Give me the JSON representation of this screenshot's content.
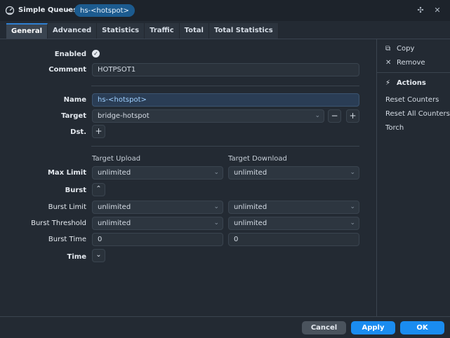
{
  "titlebar": {
    "title": "Simple Queues",
    "breadcrumb_sep": "›",
    "item": "hs-<hotspot>",
    "pin_icon": "pin-icon",
    "close_icon": "close-icon"
  },
  "tabs": [
    "General",
    "Advanced",
    "Statistics",
    "Traffic",
    "Total",
    "Total Statistics"
  ],
  "form": {
    "enabled_label": "Enabled",
    "enabled": true,
    "comment_label": "Comment",
    "comment_value": "HOTPSOT1",
    "name_label": "Name",
    "name_value": "hs-<hotspot>",
    "target_label": "Target",
    "target_value": "bridge-hotspot",
    "dst_label": "Dst.",
    "col_upload": "Target Upload",
    "col_download": "Target Download",
    "max_limit_label": "Max Limit",
    "max_limit_up": "unlimited",
    "max_limit_down": "unlimited",
    "burst_label": "Burst",
    "burst_limit_label": "Burst Limit",
    "burst_limit_up": "unlimited",
    "burst_limit_down": "unlimited",
    "burst_threshold_label": "Burst Threshold",
    "burst_threshold_up": "unlimited",
    "burst_threshold_down": "unlimited",
    "burst_time_label": "Burst Time",
    "burst_time_up": "0",
    "burst_time_down": "0",
    "time_label": "Time"
  },
  "side": {
    "copy": "Copy",
    "remove": "Remove",
    "actions": "Actions",
    "reset_counters": "Reset Counters",
    "reset_all_counters": "Reset All Counters",
    "torch": "Torch"
  },
  "footer": {
    "cancel": "Cancel",
    "apply": "Apply",
    "ok": "OK"
  },
  "colors": {
    "accent": "#1a8cf0",
    "background": "#232a33",
    "highlight_field": "#2a3d55"
  }
}
